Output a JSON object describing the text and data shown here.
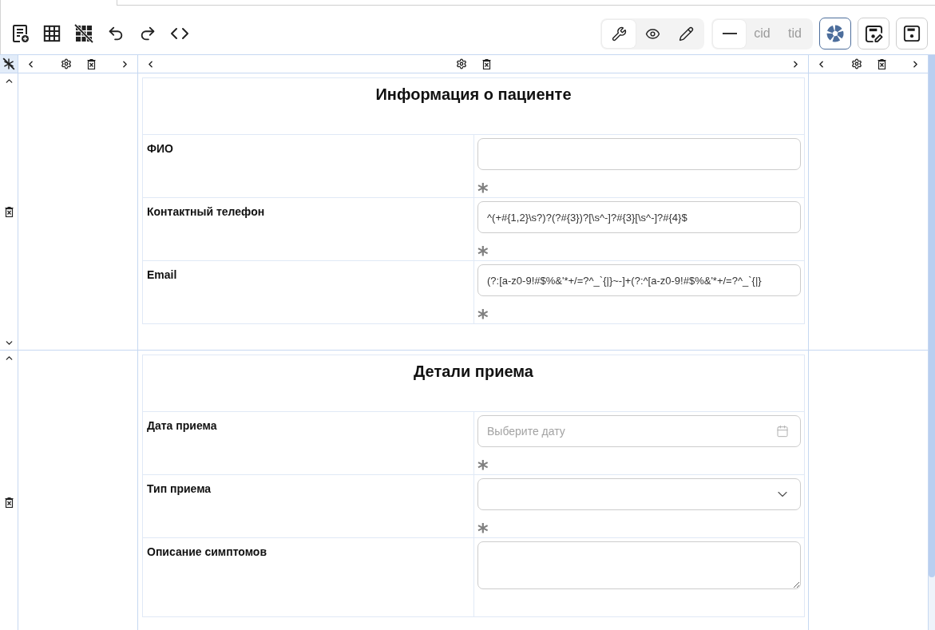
{
  "toolbar": {
    "view_modes": [
      {
        "kind": "wrench",
        "selected": true
      },
      {
        "kind": "eye",
        "selected": false
      },
      {
        "kind": "pencil",
        "selected": false
      }
    ],
    "id_modes": [
      {
        "kind": "icon",
        "selected": true
      },
      {
        "kind": "text",
        "label": "cid",
        "selected": false
      },
      {
        "kind": "text",
        "label": "tid",
        "selected": false
      }
    ],
    "actions": [
      {
        "kind": "aperture",
        "active": true
      },
      {
        "kind": "save-edit",
        "active": false
      },
      {
        "kind": "save",
        "active": false
      }
    ]
  },
  "sections": [
    {
      "title": "Информация о пациенте",
      "fields": [
        {
          "kind": "text",
          "label": "ФИО",
          "required_mark": "*"
        },
        {
          "kind": "text",
          "label": "Контактный телефон",
          "value": "^(+#{1,2}\\s?)?(?#{3})?[\\s^-]?#{3}[\\s^-]?#{4}$",
          "required_mark": "*"
        },
        {
          "kind": "text",
          "label": "Email",
          "value": "(?:[a-z0-9!#$%&'*+/=?^_`{|}~-]+(?:^[a-z0-9!#$%&'*+/=?^_`{|}",
          "required_mark": "*"
        }
      ]
    },
    {
      "title": "Детали приема",
      "fields": [
        {
          "kind": "date",
          "label": "Дата приема",
          "placeholder": "Выберите дату",
          "required_mark": "*"
        },
        {
          "kind": "select",
          "label": "Тип приема",
          "required_mark": "*"
        },
        {
          "kind": "textarea",
          "label": "Описание симптомов"
        }
      ]
    }
  ]
}
